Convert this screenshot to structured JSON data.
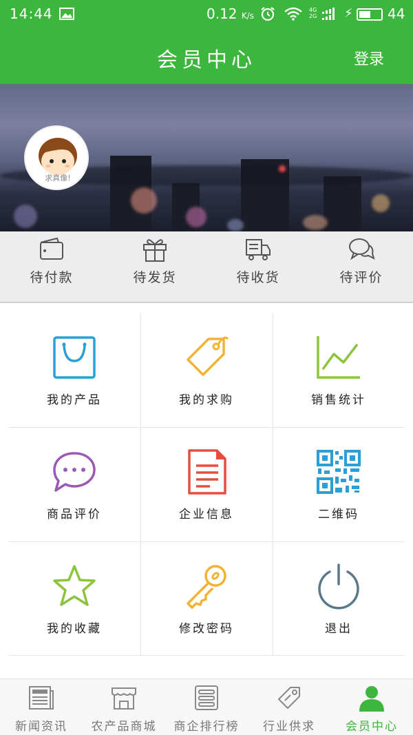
{
  "status_bar": {
    "time": "14:44",
    "speed": "0.12",
    "speed_unit": "K/s",
    "network": [
      "4G",
      "2G"
    ],
    "battery": "44"
  },
  "header": {
    "title": "会员中心",
    "login": "登录"
  },
  "avatar": {
    "caption": "求真像!"
  },
  "orders": [
    {
      "label": "待付款",
      "icon": "wallet-icon"
    },
    {
      "label": "待发货",
      "icon": "gift-icon"
    },
    {
      "label": "待收货",
      "icon": "truck-icon"
    },
    {
      "label": "待评价",
      "icon": "chat-icon"
    }
  ],
  "grid": [
    {
      "label": "我的产品",
      "icon": "shopping-bag-icon",
      "color": "#2a9fd6"
    },
    {
      "label": "我的求购",
      "icon": "tag-icon",
      "color": "#f2b233"
    },
    {
      "label": "销售统计",
      "icon": "line-chart-icon",
      "color": "#8cc43c"
    },
    {
      "label": "商品评价",
      "icon": "comment-icon",
      "color": "#9b59b6"
    },
    {
      "label": "企业信息",
      "icon": "document-icon",
      "color": "#e74c3c"
    },
    {
      "label": "二维码",
      "icon": "qr-code-icon",
      "color": "#2a9fd6"
    },
    {
      "label": "我的收藏",
      "icon": "star-icon",
      "color": "#8cc43c"
    },
    {
      "label": "修改密码",
      "icon": "key-icon",
      "color": "#f2b233"
    },
    {
      "label": "退出",
      "icon": "power-icon",
      "color": "#5a7a8c"
    }
  ],
  "tabs": [
    {
      "label": "新闻资讯",
      "icon": "news-icon",
      "active": false
    },
    {
      "label": "农产品商城",
      "icon": "store-icon",
      "active": false
    },
    {
      "label": "商企排行榜",
      "icon": "list-icon",
      "active": false
    },
    {
      "label": "行业供求",
      "icon": "price-tag-icon",
      "active": false
    },
    {
      "label": "会员中心",
      "icon": "user-icon",
      "active": true
    }
  ],
  "colors": {
    "brand": "#3cb63c",
    "tab_inactive": "#777777"
  }
}
